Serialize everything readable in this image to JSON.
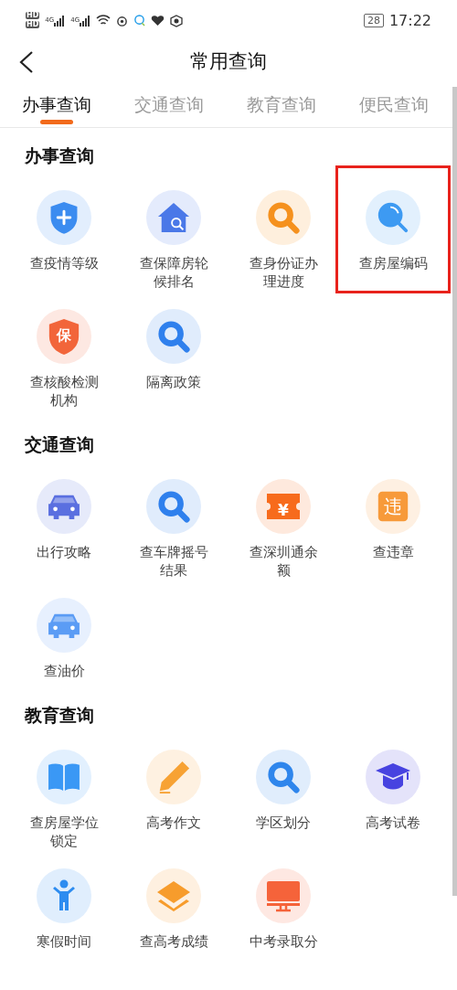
{
  "status_bar": {
    "hd_labels": [
      "HD",
      "HD"
    ],
    "network_labels": [
      "4G",
      "4G"
    ],
    "battery": "28",
    "time": "17:22"
  },
  "header": {
    "title": "常用查询"
  },
  "tabs": [
    {
      "label": "办事查询",
      "selected": true
    },
    {
      "label": "交通查询",
      "selected": false
    },
    {
      "label": "教育查询",
      "selected": false
    },
    {
      "label": "便民查询",
      "selected": false
    }
  ],
  "sections": [
    {
      "title": "办事查询",
      "items": [
        {
          "label": "查疫情等级",
          "kind": "shield-plus",
          "color": "#3b8cf0",
          "highlighted": false
        },
        {
          "label": "查保障房轮候排名",
          "kind": "house-search",
          "color": "#4a78e8",
          "highlighted": false
        },
        {
          "label": "查身份证办理进度",
          "kind": "search",
          "color": "#f5911e",
          "highlighted": false
        },
        {
          "label": "查房屋编码",
          "kind": "magnifier",
          "color": "#3d9af2",
          "highlighted": true
        },
        {
          "label": "查核酸检测机构",
          "kind": "shield-text",
          "icon_text": "保",
          "color": "#f2653a",
          "highlighted": false
        },
        {
          "label": "隔离政策",
          "kind": "search",
          "color": "#2f80ed",
          "highlighted": false
        }
      ]
    },
    {
      "title": "交通查询",
      "items": [
        {
          "label": "出行攻略",
          "kind": "car",
          "color": "#5a6fe0",
          "highlighted": false
        },
        {
          "label": "查车牌摇号结果",
          "kind": "search",
          "color": "#2f80ed",
          "highlighted": false
        },
        {
          "label": "查深圳通余额",
          "kind": "ticket",
          "icon_text": "¥",
          "color": "#f76b1c",
          "highlighted": false
        },
        {
          "label": "查违章",
          "kind": "square-text",
          "icon_text": "违",
          "color": "#f79a3a",
          "highlighted": false
        },
        {
          "label": "查油价",
          "kind": "car",
          "color": "#5b9cf5",
          "highlighted": false
        }
      ]
    },
    {
      "title": "教育查询",
      "items": [
        {
          "label": "查房屋学位锁定",
          "kind": "book",
          "color": "#3a98f5",
          "highlighted": false
        },
        {
          "label": "高考作文",
          "kind": "pencil",
          "color": "#f7a234",
          "highlighted": false
        },
        {
          "label": "学区划分",
          "kind": "search",
          "color": "#2f86ec",
          "highlighted": false
        },
        {
          "label": "高考试卷",
          "kind": "cap",
          "color": "#4743e0",
          "highlighted": false
        },
        {
          "label": "寒假时间",
          "kind": "person",
          "color": "#2d8cf0",
          "highlighted": false
        },
        {
          "label": "查高考成绩",
          "kind": "layers",
          "color": "#f79c2c",
          "highlighted": false
        },
        {
          "label": "中考录取分",
          "kind": "monitor",
          "color": "#f5633a",
          "highlighted": false
        }
      ]
    }
  ]
}
